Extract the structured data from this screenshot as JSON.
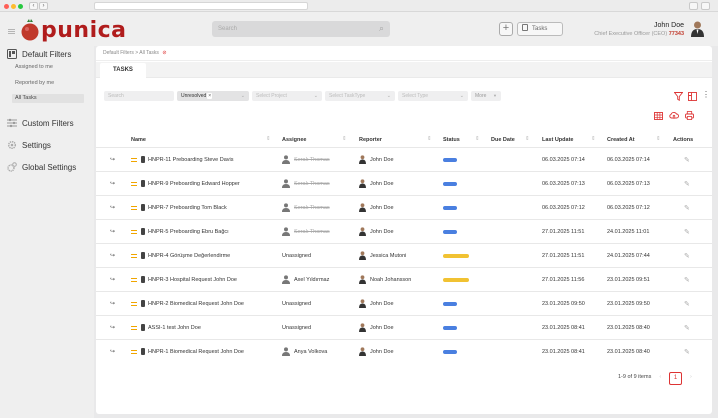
{
  "app": {
    "logo_text": "punica",
    "search_placeholder": "Search",
    "tasks_button": "Tasks",
    "user_name": "John Doe",
    "user_role": "Chief Executive Officer (CEO)",
    "user_id": "77343"
  },
  "sidebar": {
    "default_filters": "Default Filters",
    "filters": [
      "Assigned to me",
      "Reported by me",
      "All Tasks"
    ],
    "custom_filters": "Custom Filters",
    "settings": "Settings",
    "global_settings": "Global Settings"
  },
  "breadcrumb": {
    "root": "Default Filters",
    "sep": ">",
    "current": "All Tasks"
  },
  "tab": "TASKS",
  "filters_bar": {
    "search_placeholder": "Search",
    "status_value": "Unresolved",
    "project_placeholder": "Select Project",
    "tasktype_placeholder": "Select TaskType",
    "type_placeholder": "Select Type",
    "more": "More"
  },
  "table": {
    "columns": [
      "Name",
      "Assignee",
      "Reporter",
      "Status",
      "Due Date",
      "Last Update",
      "Created At",
      "Actions"
    ],
    "rows": [
      {
        "name": "HNPR-11 Preboarding Steve Davis",
        "assignee": "Serak Thomas",
        "assignee_struck": true,
        "assignee_avatar": true,
        "reporter": "John Doe",
        "status": "open",
        "due": "",
        "updated": "06.03.2025 07:14",
        "created": "06.03.2025 07:14"
      },
      {
        "name": "HNPR-9 Preboarding Edward Hopper",
        "assignee": "Serak Thomas",
        "assignee_struck": true,
        "assignee_avatar": true,
        "reporter": "John Doe",
        "status": "open",
        "due": "",
        "updated": "06.03.2025 07:13",
        "created": "06.03.2025 07:13"
      },
      {
        "name": "HNPR-7 Preboarding Tom Black",
        "assignee": "Serak Thomas",
        "assignee_struck": true,
        "assignee_avatar": true,
        "reporter": "John Doe",
        "status": "open",
        "due": "",
        "updated": "06.03.2025 07:12",
        "created": "06.03.2025 07:12"
      },
      {
        "name": "HNPR-5 Preboarding Ebru Bağcı",
        "assignee": "Serak Thomas",
        "assignee_struck": true,
        "assignee_avatar": true,
        "reporter": "John Doe",
        "status": "open",
        "due": "",
        "updated": "27.01.2025 11:51",
        "created": "24.01.2025 11:01"
      },
      {
        "name": "HNPR-4 Görüşme Değerlendirme",
        "assignee": "Unassigned",
        "assignee_struck": false,
        "assignee_avatar": false,
        "reporter": "Jessica Mutoni",
        "status": "waiting",
        "due": "",
        "updated": "27.01.2025 11:51",
        "created": "24.01.2025 07:44"
      },
      {
        "name": "HNPR-3 Hospital Request John Doe",
        "assignee": "Axel Yıldırmaz",
        "assignee_struck": false,
        "assignee_avatar": true,
        "reporter": "Noah Johansson",
        "status": "waiting",
        "due": "",
        "updated": "27.01.2025 11:56",
        "created": "23.01.2025 09:51"
      },
      {
        "name": "HNPR-2 Biomedical Request John Doe",
        "assignee": "Unassigned",
        "assignee_struck": false,
        "assignee_avatar": false,
        "reporter": "John Doe",
        "status": "open",
        "due": "",
        "updated": "23.01.2025 09:50",
        "created": "23.01.2025 09:50"
      },
      {
        "name": "ASSI-1 test John Doe",
        "assignee": "Unassigned",
        "assignee_struck": false,
        "assignee_avatar": false,
        "reporter": "John Doe",
        "status": "open",
        "due": "",
        "updated": "23.01.2025 08:41",
        "created": "23.01.2025 08:40"
      },
      {
        "name": "HNPR-1 Biomedical Request John Doe",
        "assignee": "Anya Volkova",
        "assignee_struck": false,
        "assignee_avatar": true,
        "reporter": "John Doe",
        "status": "open",
        "due": "",
        "updated": "23.01.2025 08:41",
        "created": "23.01.2025 08:40"
      }
    ]
  },
  "pagination": {
    "summary": "1-9 of 9 items",
    "current_page": "1"
  },
  "colors": {
    "brand": "#b01c1c",
    "accent_red": "#d33333",
    "status_open": "#4a7fe0",
    "status_waiting": "#f1c232"
  }
}
